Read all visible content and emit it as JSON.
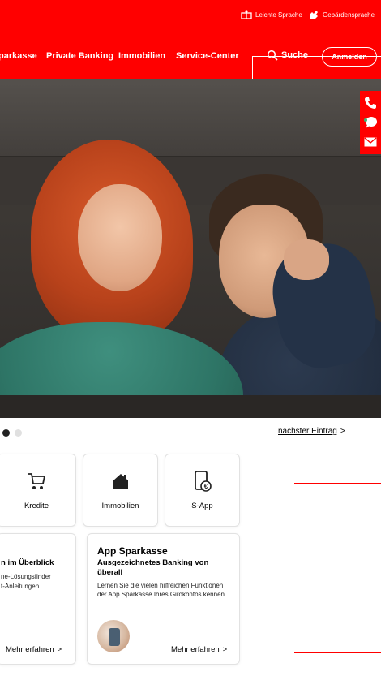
{
  "header": {
    "utility": {
      "easy_language": "Leichte Sprache",
      "sign_language": "Gebärdensprache"
    },
    "nav": [
      "parkasse",
      "Private Banking",
      "Immobilien",
      "Service-Center"
    ],
    "search_label": "Suche",
    "login_label": "Anmelden",
    "brand_color": "#ff0000"
  },
  "side_contact": {
    "icons": [
      "phone-icon",
      "chat-icon",
      "mail-icon"
    ]
  },
  "carousel": {
    "dots": 2,
    "active_dot": 1,
    "next_label": "nächster Eintrag",
    "next_arrow": ">"
  },
  "tiles": [
    {
      "label": "Kredite",
      "icon": "shopping-cart-icon"
    },
    {
      "label": "Immobilien",
      "icon": "house-icon"
    },
    {
      "label": "S-App",
      "icon": "smartphone-euro-icon"
    }
  ],
  "cards": [
    {
      "title_partial": "n im Überblick",
      "text_line1": "ne-Lösungsfinder",
      "text_line2": "t-Anleitungen",
      "more_label": "Mehr erfahren",
      "more_arrow": ">"
    },
    {
      "title": "App Sparkasse",
      "subtitle": "Ausgezeichnetes Banking von überall",
      "text": "Lernen Sie die vielen hilfreichen Funktionen der App Sparkasse Ihres Girokontos kennen.",
      "more_label": "Mehr erfahren",
      "more_arrow": ">"
    }
  ]
}
